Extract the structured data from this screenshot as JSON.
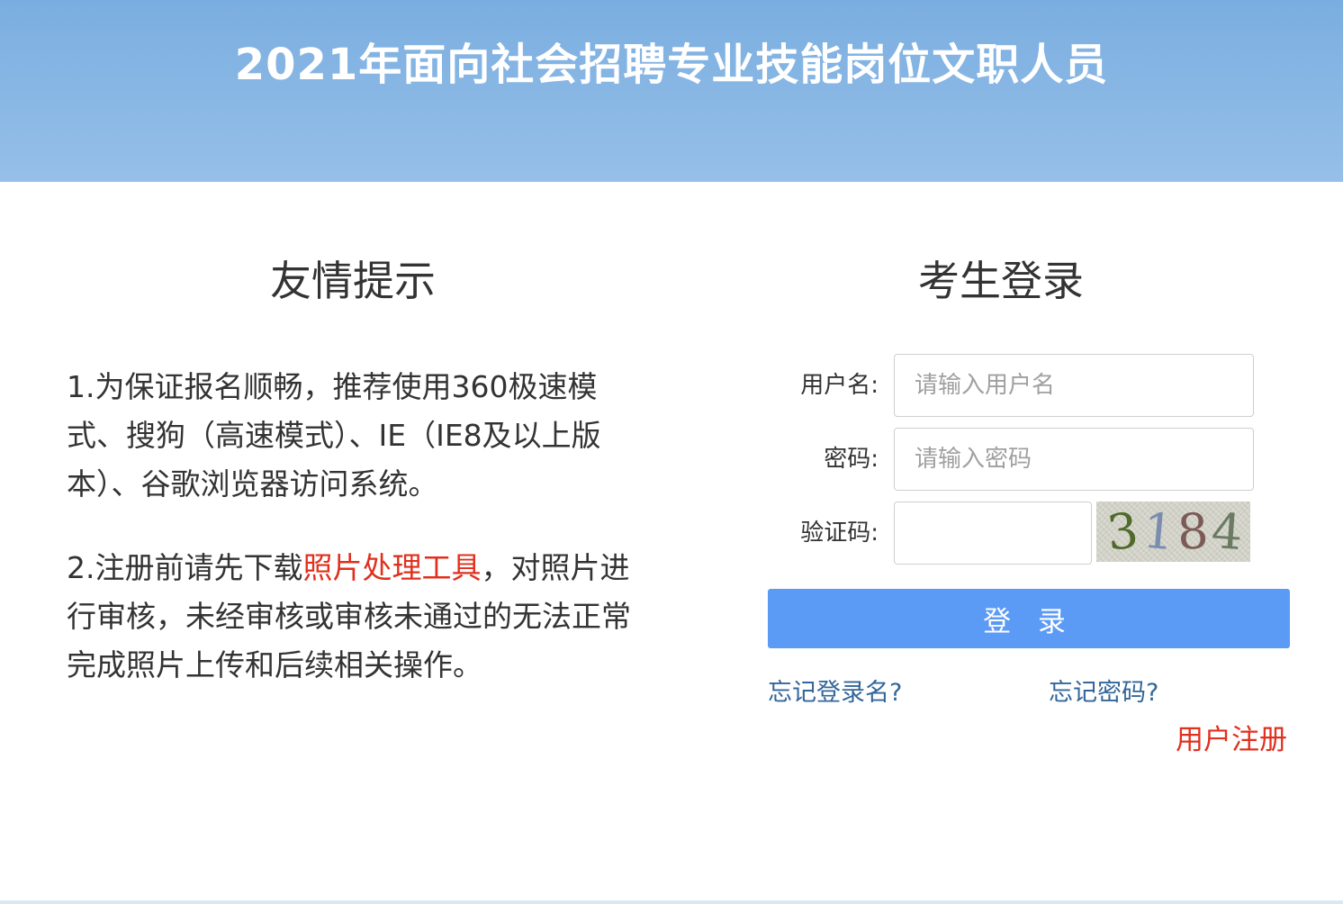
{
  "header": {
    "title": "2021年面向社会招聘专业技能岗位文职人员"
  },
  "notice": {
    "title": "友情提示",
    "item1": "1.为保证报名顺畅，推荐使用360极速模式、搜狗（高速模式）、IE（IE8及以上版本）、谷歌浏览器访问系统。",
    "item2_before": "2.注册前请先下载",
    "item2_link": "照片处理工具",
    "item2_after": "，对照片进行审核，未经审核或审核未通过的无法正常完成照片上传和后续相关操作。"
  },
  "login": {
    "title": "考生登录",
    "username_label": "用户名:",
    "username_placeholder": "请输入用户名",
    "username_value": "",
    "password_label": "密码:",
    "password_placeholder": "请输入密码",
    "password_value": "",
    "captcha_label": "验证码:",
    "captcha_value": "",
    "captcha_image_text": [
      "3",
      "1",
      "8",
      "4"
    ],
    "submit_label": "登 录",
    "forgot_username": "忘记登录名?",
    "forgot_password": "忘记密码?",
    "register": "用户注册"
  },
  "colors": {
    "header_bg": "#7aaee0",
    "button_bg": "#5b9af5",
    "link_blue": "#336699",
    "accent_red": "#e0301e"
  }
}
